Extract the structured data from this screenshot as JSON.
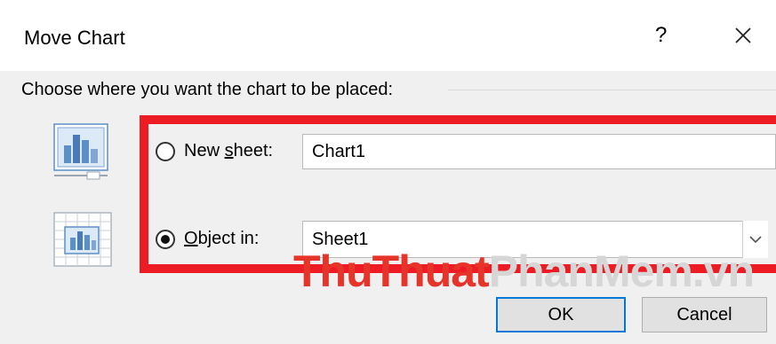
{
  "dialog": {
    "title": "Move Chart",
    "help_label": "?",
    "prompt": "Choose where you want the chart to be placed:"
  },
  "options": {
    "new_sheet": {
      "label_pre": "New ",
      "label_accel": "s",
      "label_post": "heet:",
      "value": "Chart1",
      "selected": false
    },
    "object_in": {
      "label_accel": "O",
      "label_post": "bject in:",
      "value": "Sheet1",
      "selected": true
    }
  },
  "buttons": {
    "ok": "OK",
    "cancel": "Cancel"
  },
  "watermark": {
    "part1": "ThuThuat",
    "part2": "PhanMem",
    "part3": ".vn"
  },
  "colors": {
    "highlight_border": "#ed1c24",
    "dialog_bg": "#f0f0f0",
    "title_bg": "#ffffff",
    "default_button_border": "#0078d7"
  },
  "icons": {
    "new_sheet": "chart-sheet-icon",
    "object_in": "embedded-chart-icon",
    "close": "close-icon",
    "dropdown": "chevron-down-icon"
  }
}
